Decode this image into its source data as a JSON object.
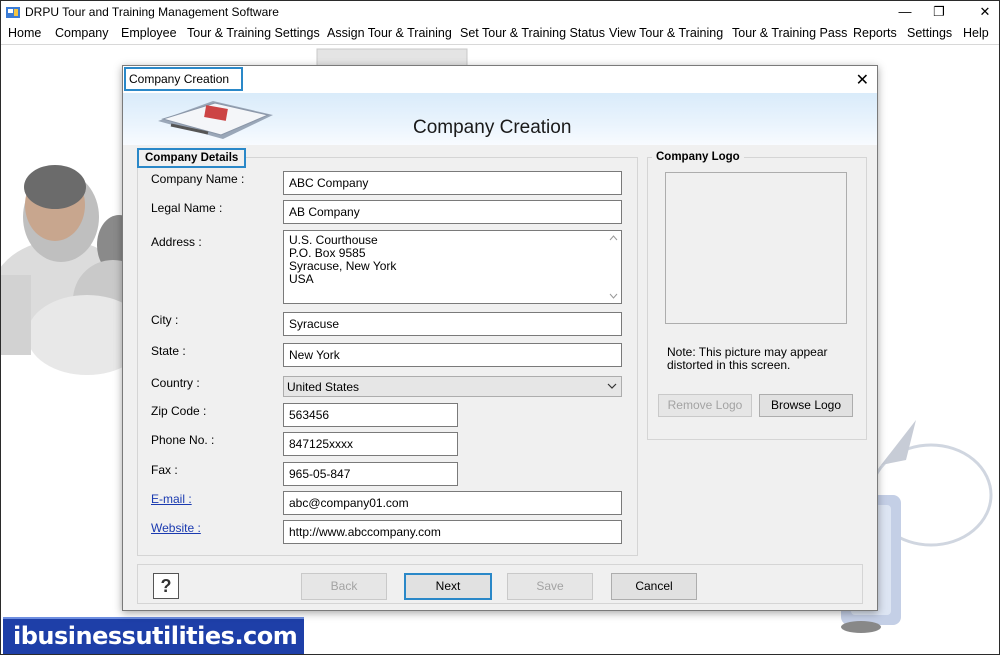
{
  "app": {
    "title": "DRPU Tour and Training Management Software"
  },
  "window_controls": {
    "minimize": "—",
    "maximize": "❐",
    "close": "✕"
  },
  "menu": [
    "Home",
    "Company",
    "Employee",
    "Tour & Training Settings",
    "Assign Tour & Training",
    "Set Tour & Training Status",
    "View Tour & Training",
    "Tour & Training Pass",
    "Reports",
    "Settings",
    "Help"
  ],
  "dialog": {
    "title": "Company Creation",
    "header_title": "Company Creation",
    "close": "✕",
    "details_group": "Company Details",
    "logo_group": "Company Logo",
    "fields": {
      "company_name": {
        "label": "Company Name :",
        "value": "ABC Company"
      },
      "legal_name": {
        "label": "Legal Name :",
        "value": "AB Company"
      },
      "address": {
        "label": "Address :",
        "value": "U.S. Courthouse\nP.O. Box 9585\nSyracuse, New York\nUSA"
      },
      "city": {
        "label": "City :",
        "value": "Syracuse"
      },
      "state": {
        "label": "State :",
        "value": "New York"
      },
      "country": {
        "label": "Country :",
        "value": "United States"
      },
      "zip": {
        "label": "Zip Code :",
        "value": "563456"
      },
      "phone": {
        "label": "Phone No. :",
        "value": "847125xxxx"
      },
      "fax": {
        "label": "Fax :",
        "value": "965-05-847"
      },
      "email": {
        "label": "E-mail :",
        "value": "abc@company01.com"
      },
      "website": {
        "label": "Website :",
        "value": "http://www.abccompany.com"
      }
    },
    "logo_note": "Note: This picture may appear distorted in this screen.",
    "remove_logo": "Remove Logo",
    "browse_logo": "Browse Logo",
    "help": "?",
    "back": "Back",
    "next": "Next",
    "save": "Save",
    "cancel": "Cancel"
  },
  "watermark": "ibusinessutilities.com",
  "colors": {
    "accent": "#2a88c8",
    "banner": "#1e3fa8",
    "link": "#1a3ab0"
  }
}
